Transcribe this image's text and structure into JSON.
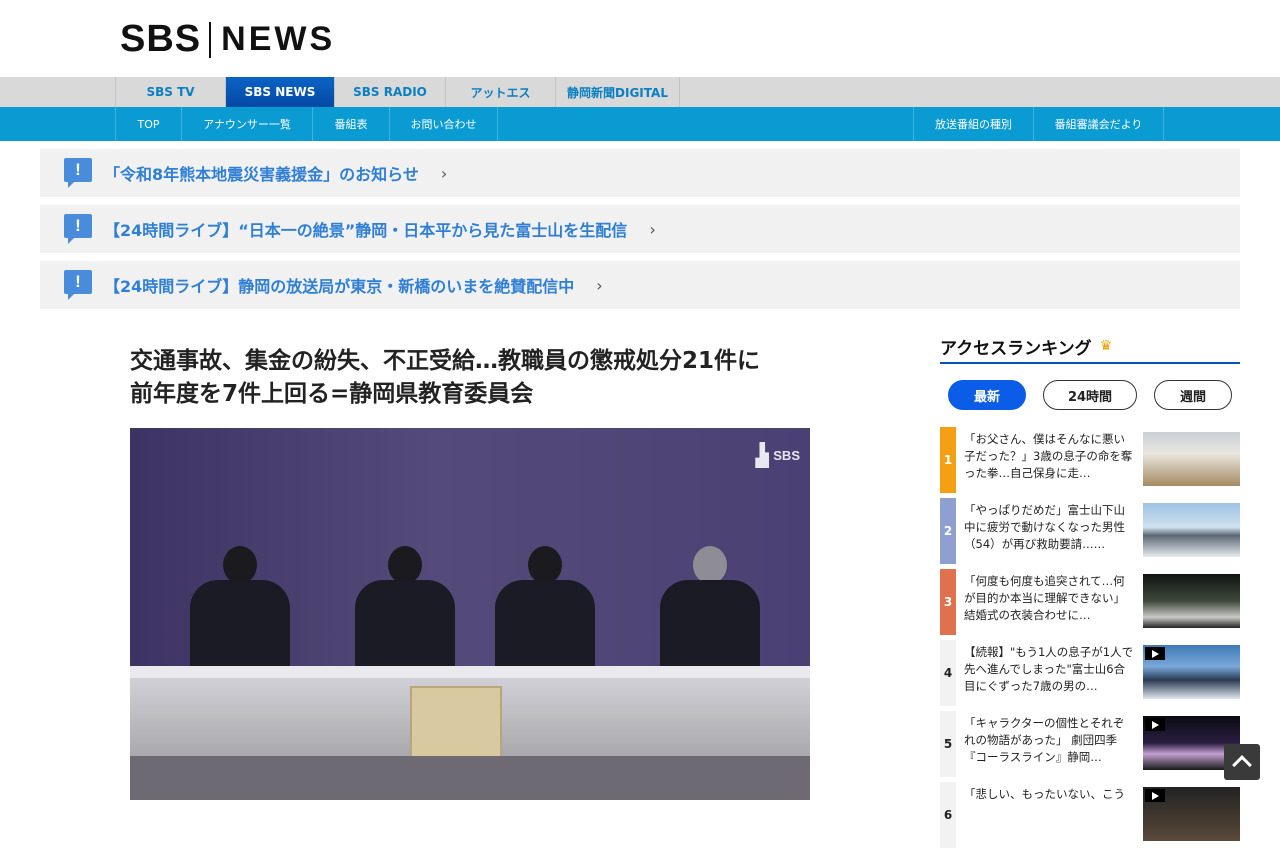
{
  "header": {
    "logo_left": "SBS",
    "logo_right": "NEWS"
  },
  "top_nav": [
    {
      "label": "SBS TV",
      "active": false
    },
    {
      "label": "SBS NEWS",
      "active": true
    },
    {
      "label": "SBS RADIO",
      "active": false
    },
    {
      "label": "アットエス",
      "active": false
    },
    {
      "label": "静岡新聞DIGITAL",
      "active": false
    }
  ],
  "sub_nav": {
    "left": [
      "TOP",
      "アナウンサー一覧",
      "番組表",
      "お問い合わせ"
    ],
    "right": [
      "放送番組の種別",
      "番組審議会だより"
    ]
  },
  "notices": [
    {
      "text": "「令和8年熊本地震災害義援金」のお知らせ"
    },
    {
      "text": "【24時間ライブ】“日本一の絶景”静岡・日本平から見た富士山を生配信"
    },
    {
      "text": "【24時間ライブ】静岡の放送局が東京・新橋のいまを絶賛配信中"
    }
  ],
  "article": {
    "title_line1": "交通事故、集金の紛失、不正受給…教職員の懲戒処分21件に",
    "title_line2": "前年度を7件上回る=静岡県教育委員会",
    "photo_watermark": "SBS"
  },
  "sidebar": {
    "title": "アクセスランキング",
    "tabs": [
      {
        "label": "最新",
        "active": true
      },
      {
        "label": "24時間",
        "active": false
      },
      {
        "label": "週間",
        "active": false
      }
    ],
    "ranking": [
      {
        "rank": "1",
        "text": "「お父さん、僕はそんなに悪い子だった？」3歳の息子の命を奪った拳…自己保身に走…",
        "color": "#f4a012",
        "thumb": "house",
        "video": false
      },
      {
        "rank": "2",
        "text": "「やっぱりだめだ」富士山下山中に疲労で動けなくなった男性（54）が再び救助要請……",
        "color": "#8f9fd1",
        "thumb": "fuji",
        "video": false
      },
      {
        "rank": "3",
        "text": "「何度も何度も追突されて…何が目的か本当に理解できない」結婚式の衣装合わせに…",
        "color": "#e0714f",
        "thumb": "road",
        "video": false
      },
      {
        "rank": "4",
        "text": "【続報】\"もう1人の息子が1人で先へ進んでしまった\"富士山6合目にぐずった7歳の男の…",
        "color": "#f2f2f2",
        "thumb": "fuji2",
        "video": true
      },
      {
        "rank": "5",
        "text": "「キャラクターの個性とそれぞれの物語があった」 劇団四季『コーラスライン』静岡…",
        "color": "#f2f2f2",
        "thumb": "stage",
        "video": true
      },
      {
        "rank": "6",
        "text": "「悲しい、もったいない、こう",
        "color": "#f2f2f2",
        "thumb": "dark",
        "video": true
      }
    ]
  }
}
